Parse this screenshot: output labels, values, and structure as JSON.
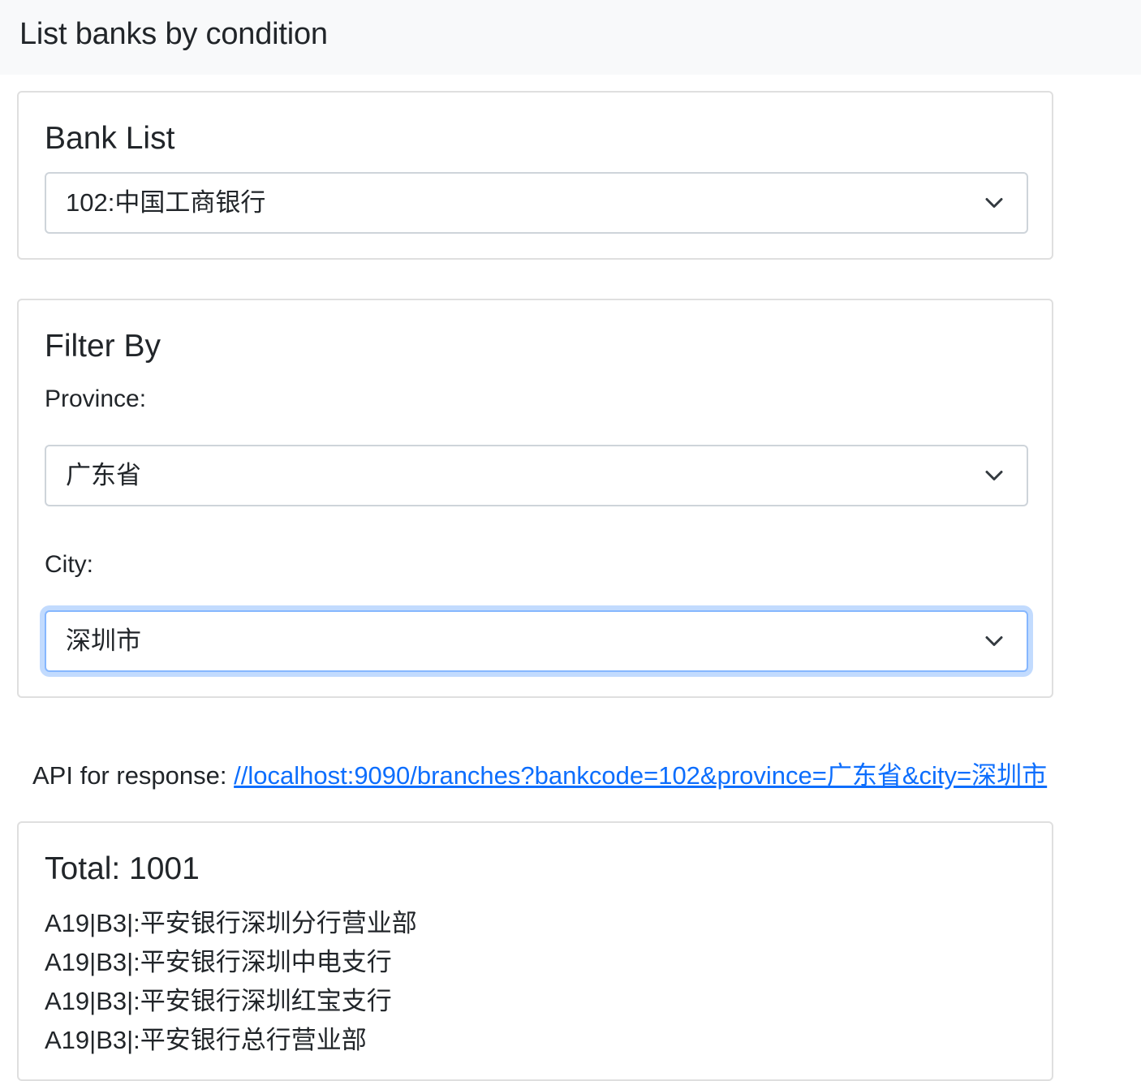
{
  "header": {
    "title": "List banks by condition"
  },
  "bank_card": {
    "title": "Bank List",
    "bank_select": {
      "value": "102:中国工商银行",
      "icon": "chevron-down-icon"
    }
  },
  "filter_card": {
    "title": "Filter By",
    "province": {
      "label": "Province:",
      "value": "广东省",
      "icon": "chevron-down-icon"
    },
    "city": {
      "label": "City:",
      "value": "深圳市",
      "icon": "chevron-down-icon",
      "focused": true
    }
  },
  "api": {
    "label": "API for response: ",
    "link_text": "//localhost:9090/branches?bankcode=102&province=广东省&city=深圳市"
  },
  "results": {
    "total_text": "Total: 1001",
    "branches": [
      "A19|B3|:平安银行深圳分行营业部",
      "A19|B3|:平安银行深圳中电支行",
      "A19|B3|:平安银行深圳红宝支行",
      "A19|B3|:平安银行总行营业部"
    ]
  },
  "colors": {
    "navbar_bg": "#f8f9fa",
    "link": "#0d6efd",
    "focus_border": "#86b7fe",
    "card_border": "#dfdfdf"
  }
}
